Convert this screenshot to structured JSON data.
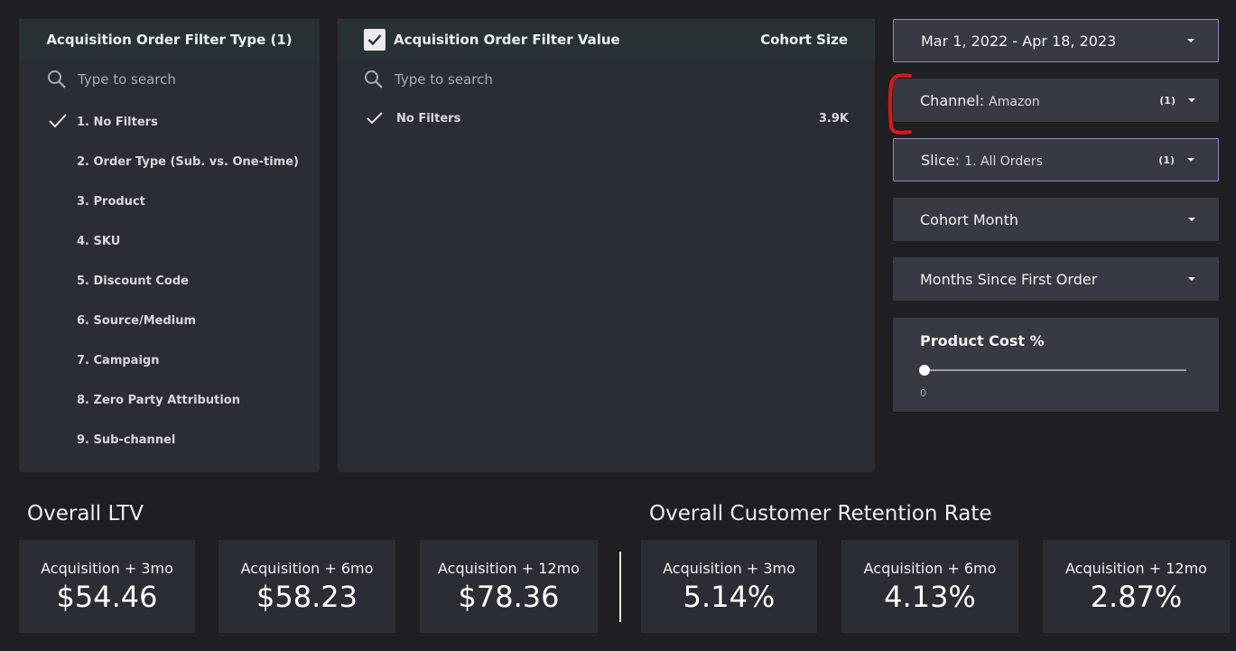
{
  "filter_type_panel": {
    "title": "Acquisition Order Filter Type (1)",
    "search_placeholder": "Type to search",
    "items": [
      {
        "label": "1. No Filters",
        "checked": true
      },
      {
        "label": "2. Order Type (Sub. vs. One-time)",
        "checked": false
      },
      {
        "label": "3. Product",
        "checked": false
      },
      {
        "label": "4. SKU",
        "checked": false
      },
      {
        "label": "5. Discount Code",
        "checked": false
      },
      {
        "label": "6. Source/Medium",
        "checked": false
      },
      {
        "label": "7. Campaign",
        "checked": false
      },
      {
        "label": "8. Zero Party Attribution",
        "checked": false
      },
      {
        "label": "9. Sub-channel",
        "checked": false
      }
    ]
  },
  "filter_value_panel": {
    "title": "Acquisition Order Filter Value",
    "metric_header": "Cohort Size",
    "search_placeholder": "Type to search",
    "rows": [
      {
        "label": "No Filters",
        "value": "3.9K",
        "checked": true
      }
    ]
  },
  "controls": {
    "date_range": "Mar 1, 2022 - Apr 18, 2023",
    "channel": {
      "label": "Channel",
      "value": "Amazon",
      "count": "(1)"
    },
    "slice": {
      "label": "Slice",
      "value": "1. All Orders",
      "count": "(1)"
    },
    "cohort_month": "Cohort Month",
    "months_since": "Months Since First Order",
    "product_cost": {
      "label": "Product Cost %",
      "min_label": "0",
      "value": 0
    }
  },
  "ltv": {
    "title": "Overall LTV",
    "kpis": [
      {
        "label": "Acquisition + 3mo",
        "value": "$54.46"
      },
      {
        "label": "Acquisition + 6mo",
        "value": "$58.23"
      },
      {
        "label": "Acquisition + 12mo",
        "value": "$78.36"
      }
    ]
  },
  "retention": {
    "title": "Overall Customer Retention Rate",
    "kpis": [
      {
        "label": "Acquisition + 3mo",
        "value": "5.14%"
      },
      {
        "label": "Acquisition + 6mo",
        "value": "4.13%"
      },
      {
        "label": "Acquisition + 12mo",
        "value": "2.87%"
      }
    ]
  },
  "colors": {
    "background": "#1e1f23",
    "panel": "#2b2d34",
    "control": "#373a42",
    "outline": "#8f86bd",
    "annotation": "#e0141b"
  }
}
